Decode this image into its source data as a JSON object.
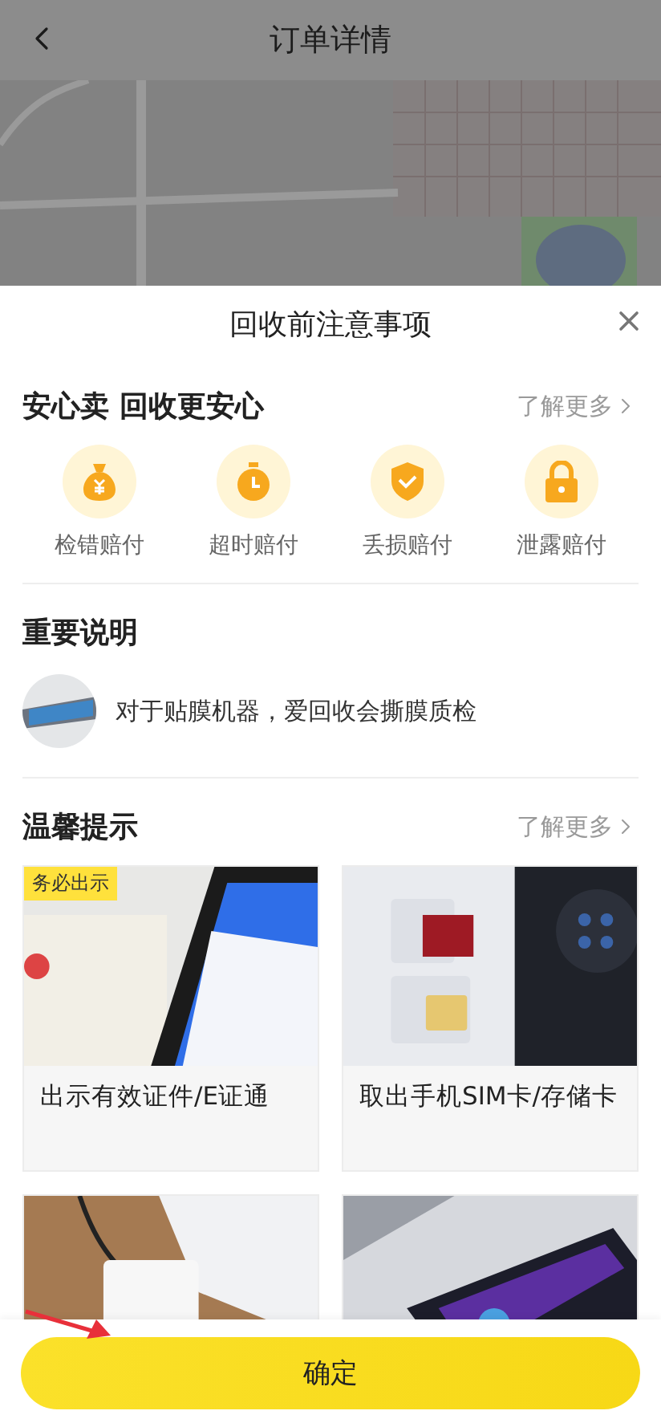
{
  "header": {
    "title": "订单详情"
  },
  "sheet": {
    "title": "回收前注意事项"
  },
  "guarantee": {
    "title": "安心卖 回收更安心",
    "more": "了解更多",
    "items": [
      {
        "kind": "money",
        "label": "检错赔付"
      },
      {
        "kind": "timer",
        "label": "超时赔付"
      },
      {
        "kind": "shield",
        "label": "丢损赔付"
      },
      {
        "kind": "lock",
        "label": "泄露赔付"
      }
    ]
  },
  "notice": {
    "title": "重要说明",
    "text": "对于贴膜机器，爱回收会撕膜质检"
  },
  "tips": {
    "title": "温馨提示",
    "more": "了解更多",
    "cards": [
      {
        "kind": "id",
        "badge": "务必出示",
        "caption": "出示有效证件/E证通"
      },
      {
        "kind": "sim",
        "caption": "取出手机SIM卡/存储卡"
      },
      {
        "kind": "drive"
      },
      {
        "kind": "phone"
      }
    ]
  },
  "confirm": {
    "label": "确定"
  }
}
